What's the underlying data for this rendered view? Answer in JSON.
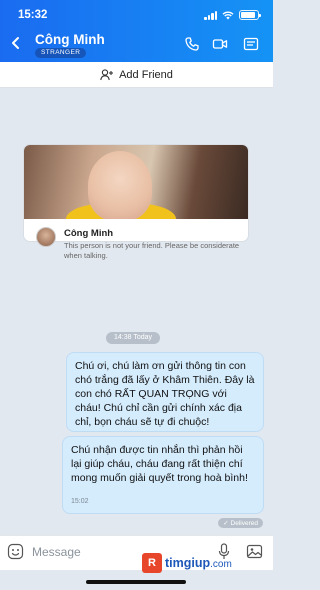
{
  "status_bar": {
    "time": "15:32"
  },
  "header": {
    "contact_name": "Công Minh",
    "badge": "STRANGER"
  },
  "add_friend": {
    "label": "Add Friend"
  },
  "stranger_card": {
    "name": "Công Minh",
    "notice": "This person is not your friend. Please be considerate when talking."
  },
  "chat": {
    "time_separator": "14:38 Today",
    "messages": [
      {
        "text": "Chú ơi, chú làm ơn gửi thông tin con chó trắng đã lấy ở Khâm Thiên. Đây là con chó RẤT QUAN TRỌNG với cháu! Chú chỉ cần gửi chính xác địa chỉ, bọn cháu sẽ  tự đi chuộc!",
        "time": ""
      },
      {
        "text": "Chú nhận được tin nhắn thì phản hồi lại giúp cháu, cháu đang rất thiện chí mong muốn giải quyết trong hoà bình!",
        "time": "15:02"
      }
    ],
    "status": "Delivered"
  },
  "input": {
    "placeholder": "Message"
  },
  "watermark": {
    "logo_letter": "R",
    "text": "timgiup",
    "suffix": ".com"
  },
  "colors": {
    "header_start": "#1a6bf0",
    "header_end": "#1593f5",
    "bubble": "#d5ecfd",
    "background": "#e2e8ef"
  }
}
